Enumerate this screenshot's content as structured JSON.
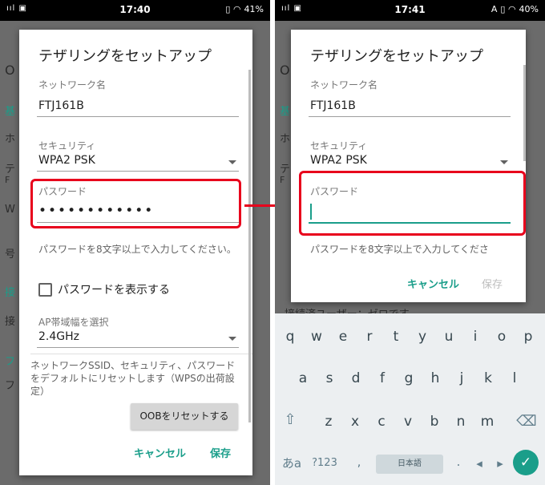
{
  "left": {
    "status": {
      "signal": "ııl",
      "sim": "▣",
      "time": "17:40",
      "icons": "▯ ◠",
      "battery": "41%"
    },
    "bg_fragments": [
      "O",
      "基",
      "ホ",
      "テ",
      "F",
      "W",
      "号",
      "接",
      "接",
      "フ",
      "フ"
    ],
    "dialog": {
      "title": "テザリングをセットアップ",
      "network_label": "ネットワーク名",
      "network_value": "FTJ161B",
      "security_label": "セキュリティ",
      "security_value": "WPA2 PSK",
      "password_label": "パスワード",
      "password_dots": "••••••••••••",
      "password_hint": "パスワードを8文字以上で入力してください。",
      "show_password": "パスワードを表示する",
      "ap_label": "AP帯域幅を選択",
      "ap_value": "2.4GHz",
      "reset_text": "ネットワークSSID、セキュリティ、パスワードをデフォルトにリセットします（WPSの出荷設定）",
      "oob_button": "OOBをリセットする",
      "cancel": "キャンセル",
      "save": "保存"
    }
  },
  "right": {
    "status": {
      "signal": "ııl",
      "sim": "▣",
      "time": "17:41",
      "letter": "A",
      "icons": "▯ ◠",
      "battery": "40%"
    },
    "bg_fragments": [
      "O",
      "基",
      "ホ",
      "テ",
      "F",
      "接"
    ],
    "bg_line": "接続済ユーザー：ゼロです",
    "dialog": {
      "title": "テザリングをセットアップ",
      "network_label": "ネットワーク名",
      "network_value": "FTJ161B",
      "security_label": "セキュリティ",
      "security_value": "WPA2 PSK",
      "password_label": "パスワード",
      "password_hint": "パスワードを8文字以上で入力してくださ",
      "cancel": "キャンセル",
      "save": "保存"
    },
    "keyboard": {
      "row1": [
        "q",
        "w",
        "e",
        "r",
        "t",
        "y",
        "u",
        "i",
        "o",
        "p"
      ],
      "row2": [
        "a",
        "s",
        "d",
        "f",
        "g",
        "h",
        "j",
        "k",
        "l"
      ],
      "row3": [
        "z",
        "x",
        "c",
        "v",
        "b",
        "n",
        "m"
      ],
      "shift_icon": "shift-icon",
      "backspace_icon": "backspace-icon",
      "kana": "あa",
      "numbers": "?123",
      "comma": ",",
      "space_label": "日本語",
      "period": ".",
      "left_arrow": "◂",
      "right_arrow": "▸",
      "enter_icon": "check-icon"
    }
  },
  "colors": {
    "accent": "#1a9e8a",
    "highlight": "#e8001c"
  }
}
